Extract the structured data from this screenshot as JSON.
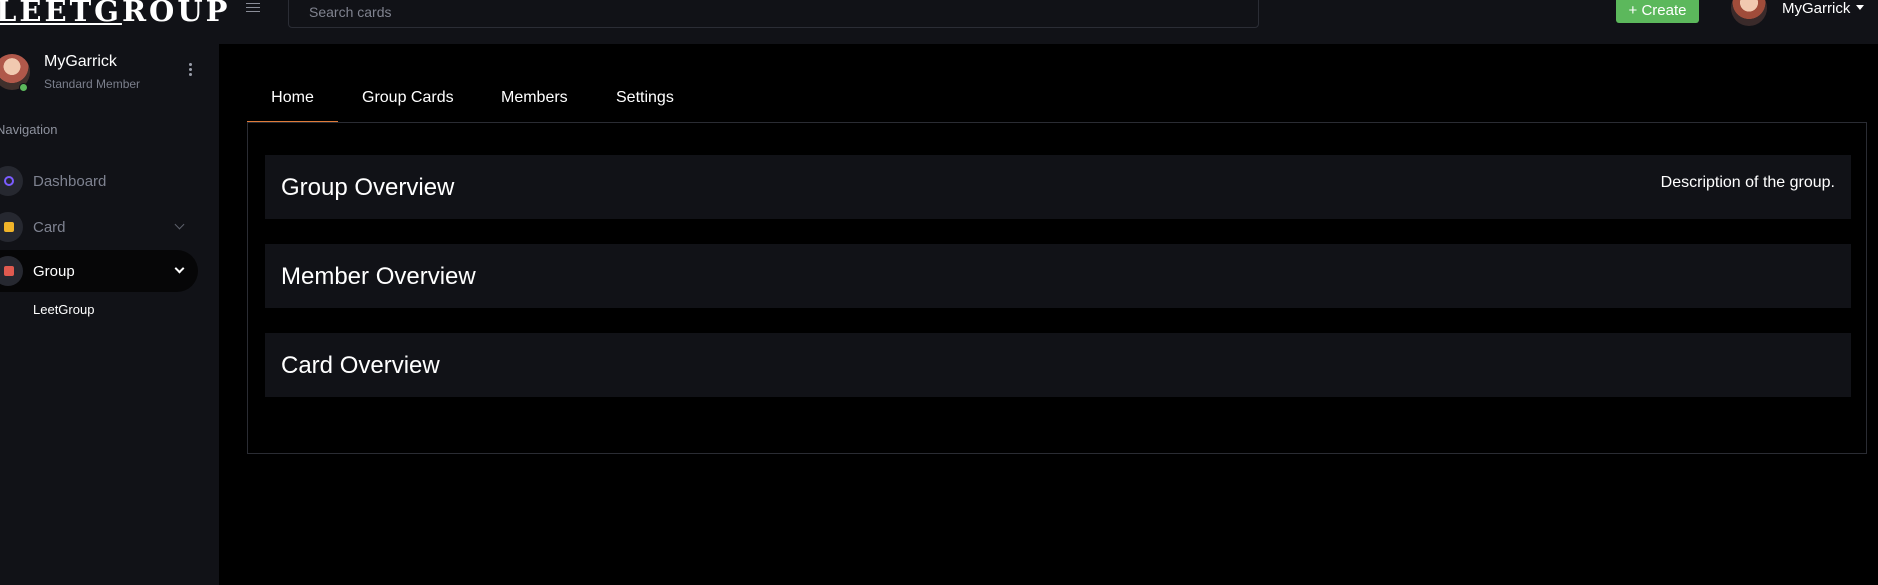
{
  "header": {
    "logo_text_a": "LEETG",
    "logo_text_b": "ROUP",
    "search_placeholder": "Search cards",
    "create_label": "+ Create",
    "username": "MyGarrick"
  },
  "sidebar": {
    "user_name": "MyGarrick",
    "user_role": "Standard Member",
    "heading": "Navigation",
    "items": [
      {
        "label": "Dashboard",
        "icon": "dashboard-gauge-icon",
        "color": "#7b5cff"
      },
      {
        "label": "Card",
        "icon": "card-icon",
        "color": "#f0b429"
      },
      {
        "label": "Group",
        "icon": "group-icon",
        "color": "#e05a4f"
      }
    ],
    "sub_items": [
      "LeetGroup"
    ]
  },
  "tabs": [
    "Home",
    "Group Cards",
    "Members",
    "Settings"
  ],
  "cards": [
    {
      "title": "Group Overview",
      "description": "Description of the group."
    },
    {
      "title": "Member Overview"
    },
    {
      "title": "Card Overview"
    }
  ],
  "colors": {
    "accent_tab": "#e07b39",
    "create_button": "#5cb85c",
    "online_status": "#5cb85c"
  }
}
